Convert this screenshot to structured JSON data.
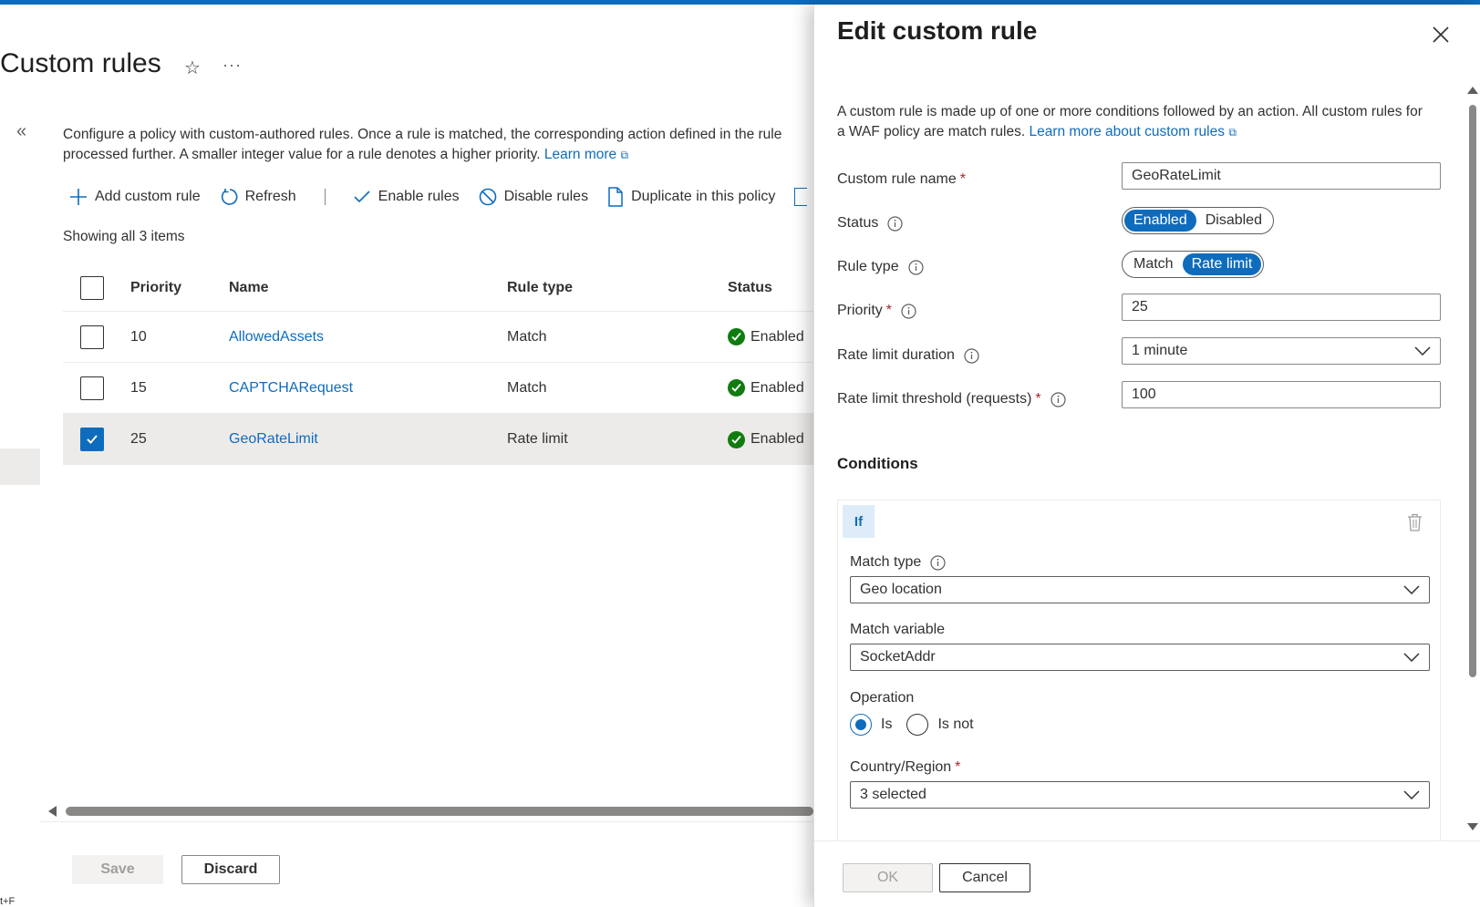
{
  "page": {
    "title": "Custom rules",
    "more_label": "···",
    "description_line1": "Configure a policy with custom-authored rules. Once a rule is matched, the corresponding action defined in the rule",
    "description_line2": "processed further. A smaller integer value for a rule denotes a higher priority.",
    "learn_more": "Learn more",
    "toolbar": {
      "add": "Add custom rule",
      "refresh": "Refresh",
      "enable": "Enable rules",
      "disable": "Disable rules",
      "duplicate": "Duplicate in this policy"
    },
    "items_count": "Showing all 3 items",
    "table": {
      "headers": {
        "priority": "Priority",
        "name": "Name",
        "rule_type": "Rule type",
        "status": "Status"
      },
      "rows": [
        {
          "priority": "10",
          "name": "AllowedAssets",
          "rule_type": "Match",
          "status": "Enabled",
          "selected": false
        },
        {
          "priority": "15",
          "name": "CAPTCHARequest",
          "rule_type": "Match",
          "status": "Enabled",
          "selected": false
        },
        {
          "priority": "25",
          "name": "GeoRateLimit",
          "rule_type": "Rate limit",
          "status": "Enabled",
          "selected": true
        }
      ]
    },
    "save_label": "Save",
    "discard_label": "Discard",
    "shortcut_hint": "t+F"
  },
  "panel": {
    "title": "Edit custom rule",
    "description": "A custom rule is made up of one or more conditions followed by an action. All custom rules for a WAF policy are match rules.",
    "learn_more": "Learn more about custom rules",
    "fields": {
      "name_label": "Custom rule name",
      "name_value": "GeoRateLimit",
      "status_label": "Status",
      "status_options": [
        "Enabled",
        "Disabled"
      ],
      "status_selected": "Enabled",
      "rule_type_label": "Rule type",
      "rule_type_options": [
        "Match",
        "Rate limit"
      ],
      "rule_type_selected": "Rate limit",
      "priority_label": "Priority",
      "priority_value": "25",
      "duration_label": "Rate limit duration",
      "duration_value": "1 minute",
      "threshold_label": "Rate limit threshold (requests)",
      "threshold_value": "100"
    },
    "conditions": {
      "title": "Conditions",
      "if_label": "If",
      "match_type_label": "Match type",
      "match_type_value": "Geo location",
      "match_variable_label": "Match variable",
      "match_variable_value": "SocketAddr",
      "operation_label": "Operation",
      "operation_options": [
        "Is",
        "Is not"
      ],
      "operation_selected": "Is",
      "country_label": "Country/Region",
      "country_value": "3 selected"
    },
    "ok_label": "OK",
    "cancel_label": "Cancel"
  },
  "colors": {
    "accent": "#0f6cbd",
    "success": "#107c10",
    "required": "#a4262c"
  }
}
